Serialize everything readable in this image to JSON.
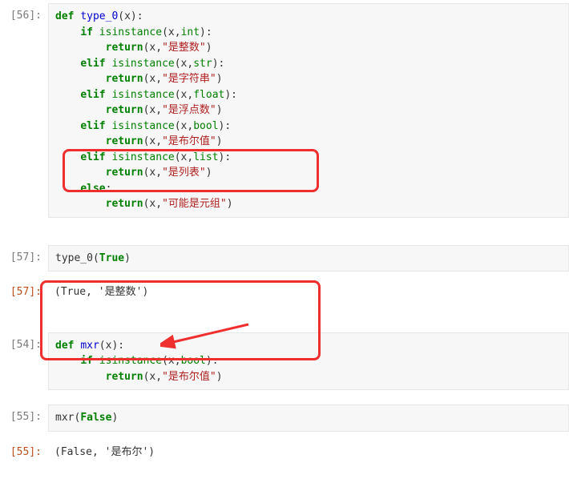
{
  "cells": {
    "c56": {
      "prompt": "[56]:",
      "line1_def": "def",
      "line1_name": "type_0",
      "line1_rest": "(x):",
      "l2_kw": "if",
      "l2_fn": "isinstance",
      "l2_args": "(x,",
      "l2_type": "int",
      "l2_close": "):",
      "l3_kw": "return",
      "l3_open": "(x,",
      "l3_str": "\"是整数\"",
      "l3_close": ")",
      "l4_kw": "elif",
      "l4_fn": "isinstance",
      "l4_args": "(x,",
      "l4_type": "str",
      "l4_close": "):",
      "l5_kw": "return",
      "l5_open": "(x,",
      "l5_str": "\"是字符串\"",
      "l5_close": ")",
      "l6_kw": "elif",
      "l6_fn": "isinstance",
      "l6_args": "(x,",
      "l6_type": "float",
      "l6_close": "):",
      "l7_kw": "return",
      "l7_open": "(x,",
      "l7_str": "\"是浮点数\"",
      "l7_close": ")",
      "l8_kw": "elif",
      "l8_fn": "isinstance",
      "l8_args": "(x,",
      "l8_type": "bool",
      "l8_close": "):",
      "l9_kw": "return",
      "l9_open": "(x,",
      "l9_str": "\"是布尔值\"",
      "l9_close": ")",
      "l10_kw": "elif",
      "l10_fn": "isinstance",
      "l10_args": "(x,",
      "l10_type": "list",
      "l10_close": "):",
      "l11_kw": "return",
      "l11_open": "(x,",
      "l11_str": "\"是列表\"",
      "l11_close": ")",
      "l12_kw": "else",
      "l12_colon": ":",
      "l13_kw": "return",
      "l13_open": "(x,",
      "l13_str": "\"可能是元组\"",
      "l13_close": ")"
    },
    "c57in": {
      "prompt": "[57]:",
      "fn": "type_0",
      "open": "(",
      "arg": "True",
      "close": ")"
    },
    "c57out": {
      "prompt": "[57]:",
      "text": "(True, '是整数')"
    },
    "c54": {
      "prompt": "[54]:",
      "l1_def": "def",
      "l1_name": "mxr",
      "l1_rest": "(x):",
      "l2_kw": "if",
      "l2_fn": "isinstance",
      "l2_args": "(x,",
      "l2_type": "bool",
      "l2_close": "):",
      "l3_kw": "return",
      "l3_open": "(x,",
      "l3_str": "\"是布尔值\"",
      "l3_close": ")"
    },
    "c55in": {
      "prompt": "[55]:",
      "fn": "mxr",
      "open": "(",
      "arg": "False",
      "close": ")"
    },
    "c55out": {
      "prompt": "[55]:",
      "text": "(False, '是布尔')"
    }
  }
}
